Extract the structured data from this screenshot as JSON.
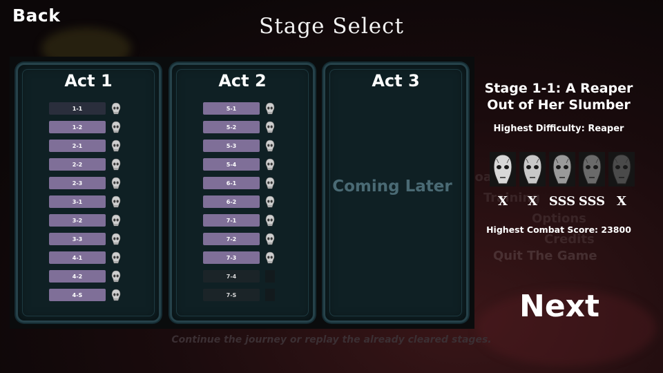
{
  "header": {
    "back_label": "Back",
    "title": "Stage Select"
  },
  "acts": [
    {
      "title": "Act 1",
      "stages": [
        {
          "label": "1-1",
          "state": "selected"
        },
        {
          "label": "1-2",
          "state": "cleared"
        },
        {
          "label": "2-1",
          "state": "cleared"
        },
        {
          "label": "2-2",
          "state": "cleared"
        },
        {
          "label": "2-3",
          "state": "cleared"
        },
        {
          "label": "3-1",
          "state": "cleared"
        },
        {
          "label": "3-2",
          "state": "cleared"
        },
        {
          "label": "3-3",
          "state": "cleared"
        },
        {
          "label": "4-1",
          "state": "cleared"
        },
        {
          "label": "4-2",
          "state": "cleared"
        },
        {
          "label": "4-S",
          "state": "cleared"
        }
      ]
    },
    {
      "title": "Act 2",
      "stages": [
        {
          "label": "5-1",
          "state": "cleared"
        },
        {
          "label": "5-2",
          "state": "cleared"
        },
        {
          "label": "5-3",
          "state": "cleared"
        },
        {
          "label": "5-4",
          "state": "cleared"
        },
        {
          "label": "6-1",
          "state": "cleared"
        },
        {
          "label": "6-2",
          "state": "cleared"
        },
        {
          "label": "7-1",
          "state": "cleared"
        },
        {
          "label": "7-2",
          "state": "cleared"
        },
        {
          "label": "7-3",
          "state": "cleared"
        },
        {
          "label": "7-4",
          "state": "locked"
        },
        {
          "label": "7-S",
          "state": "locked"
        }
      ]
    },
    {
      "title": "Act 3",
      "stages": [],
      "placeholder": "Coming Later"
    }
  ],
  "details": {
    "stage_name_line1": "Stage 1-1: A Reaper",
    "stage_name_line2": "Out of Her Slumber",
    "highest_difficulty": "Highest Difficulty: Reaper",
    "masks": [
      {
        "icon": "pale-woman-mask-icon",
        "rank": "X"
      },
      {
        "icon": "weeping-face-mask-icon",
        "rank": "X"
      },
      {
        "icon": "skull-mask-icon",
        "rank": "SSS"
      },
      {
        "icon": "plague-doctor-mask-icon",
        "rank": "SSS"
      },
      {
        "icon": "dark-plague-mask-icon",
        "rank": "X"
      }
    ],
    "highest_score": "Highest Combat Score: 23800",
    "next_label": "Next"
  },
  "footer_hint": "Continue the journey or replay the already cleared stages.",
  "background_menu_ghosts": [
    "Load",
    "Training",
    "Options",
    "Credits",
    "Quit The Game"
  ],
  "colors": {
    "stage_button": "#7f6f98",
    "panel_frame": "#26424a",
    "panel_fill": "#0f2024",
    "placeholder_text": "#4a6a74"
  }
}
